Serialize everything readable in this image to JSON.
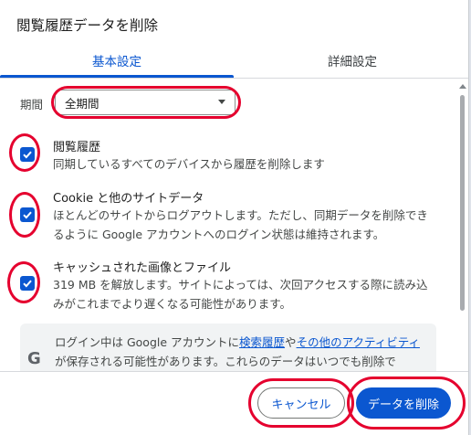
{
  "dialog": {
    "title": "閲覧履歴データを削除",
    "tabs": [
      {
        "label": "基本設定",
        "selected": true
      },
      {
        "label": "詳細設定",
        "selected": false
      }
    ],
    "period": {
      "label": "期間",
      "value": "全期間"
    },
    "items": [
      {
        "title": "閲覧履歴",
        "description": "同期しているすべてのデバイスから履歴を削除します",
        "checked": true
      },
      {
        "title": "Cookie と他のサイトデータ",
        "description": "ほとんどのサイトからログアウトします。ただし、同期データを削除できるように Google アカウントへのログイン状態は維持されます。",
        "checked": true
      },
      {
        "title": "キャッシュされた画像とファイル",
        "description": "319 MB を解放します。サイトによっては、次回アクセスする際に読み込みがこれまでより遅くなる可能性があります。",
        "checked": true
      }
    ],
    "info": {
      "icon": "google-g-icon",
      "text_1": "ログイン中は Google アカウントに",
      "link_1": "検索履歴",
      "text_2": "や",
      "link_2": "その他のアクティビティ",
      "text_3": "が保存される可能性があります。これらのデータはいつでも削除で"
    },
    "buttons": {
      "cancel": "キャンセル",
      "delete": "データを削除"
    }
  },
  "colors": {
    "accent": "#0b57d0",
    "annotation": "#e5002e"
  }
}
